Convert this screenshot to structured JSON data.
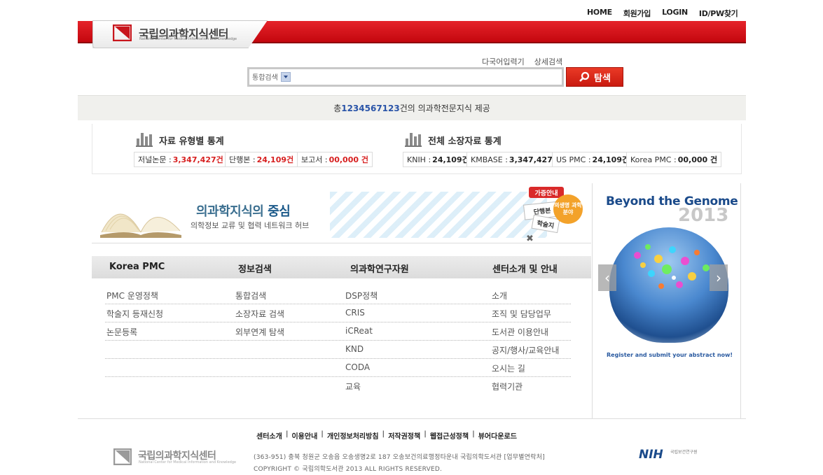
{
  "top_nav": [
    "HOME",
    "회원가입",
    "LOGIN",
    "ID/PW찾기"
  ],
  "logo": {
    "title": "국립의과학지식센터",
    "subtitle": "National Center for Medical Information and Knowledge"
  },
  "search": {
    "links": [
      "다국어입력기",
      "상세검색"
    ],
    "select_value": "통합검색",
    "input_value": "",
    "button_label": "탐색"
  },
  "total": {
    "prefix": "총 ",
    "count": "1234567123",
    "suffix": "건의 의과학전문지식 제공"
  },
  "stats": {
    "type_title": "자료 유형별 통계",
    "type_chips": [
      {
        "label": "저널논문 : ",
        "value": "3,347,427건"
      },
      {
        "label": "단행본 : ",
        "value": "24,109건"
      },
      {
        "label": "보고서 : ",
        "value": "00,000 건"
      }
    ],
    "holdings_title": "전체 소장자료 통계",
    "holdings_chips": [
      {
        "label": "KNIH : ",
        "value": "24,109건"
      },
      {
        "label": "KMBASE : ",
        "value": "3,347,427건"
      },
      {
        "label": "US PMC : ",
        "value": "24,109건"
      },
      {
        "label": "Korea PMC : ",
        "value": "00,000 건"
      }
    ]
  },
  "banner": {
    "title_part1": "의과학지식의 ",
    "title_part2": "중심",
    "subtitle": "의학정보 교류 및 협력 네트워크 허브",
    "guide_tag": "가증안내",
    "circle_text": "의생명 과학분야",
    "paper1": "단행본",
    "paper2": "학술지",
    "close": "✖"
  },
  "menu": {
    "columns": [
      {
        "title": "Korea PMC",
        "items": [
          "PMC 운영정책",
          "학술지 등재신청",
          "논문등록"
        ]
      },
      {
        "title": "정보검색",
        "items": [
          "통합검색",
          "소장자료 검색",
          "외부연계 탐색"
        ]
      },
      {
        "title": "의과학연구자원",
        "items": [
          "DSP정책",
          "CRIS",
          "iCReat",
          "KND",
          "CODA",
          "교육"
        ]
      },
      {
        "title": "센터소개 및 안내",
        "items": [
          "소개",
          "조직 및 담당업무",
          "도서관 이용안내",
          "공지/행사/교육안내",
          "오시는 길",
          "협력기관"
        ]
      }
    ]
  },
  "promo": {
    "title": "Beyond the Genome",
    "year": "2013",
    "caption": "Register and submit your abstract now!",
    "prev": "‹",
    "next": "›"
  },
  "footer": {
    "links": [
      "센터소개",
      "이용안내",
      "개인정보처리방침",
      "저작권정책",
      "웹접근성정책",
      "뷰어다운로드"
    ],
    "logo_title": "국립의과학지식센터",
    "logo_subtitle": "National Center for Medical Information and Knowledge",
    "address": "(363-951) 충북 청원군 오송읍 오송생명2로 187 오송보건의료행정타운내 국립의학도서관 [업무별연락처]",
    "copyright": "COPYRIGHT © 국립의학도서관 2013 ALL RIGHTS RESERVED.",
    "nih_logo": "NIH",
    "nih_sub": "국립보건연구원"
  },
  "colors": {
    "brand_red": "#d0141b",
    "accent_blue": "#2a54a8",
    "stat_red": "#d72020"
  }
}
